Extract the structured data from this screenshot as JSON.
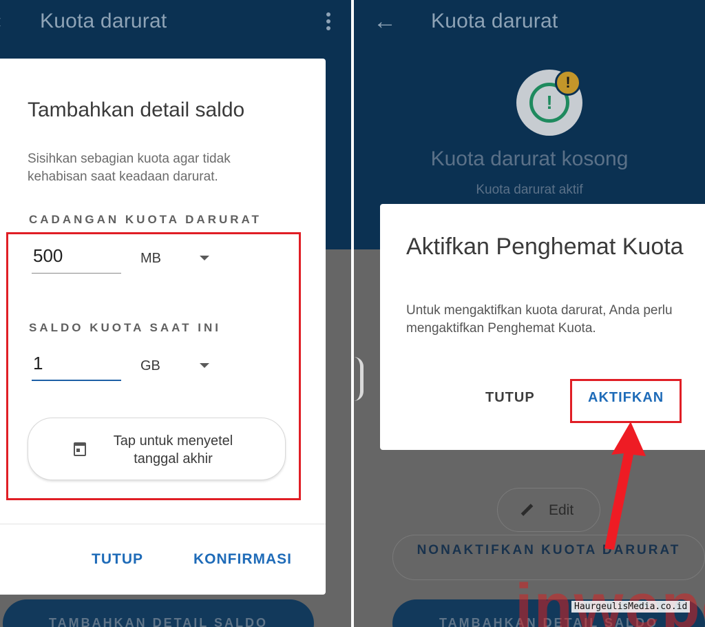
{
  "left": {
    "appbar": {
      "title": "Kuota darurat"
    },
    "dialog": {
      "title": "Tambahkan detail saldo",
      "description": "Sisihkan sebagian kuota agar tidak kehabisan saat keadaan darurat.",
      "reserve_label": "CADANGAN KUOTA DARURAT",
      "reserve_value": "500",
      "reserve_unit": "MB",
      "balance_label": "SALDO KUOTA SAAT INI",
      "balance_value": "1",
      "balance_unit": "GB",
      "date_button_label": "Tap untuk menyetel tanggal akhir",
      "close_label": "TUTUP",
      "confirm_label": "KONFIRMASI"
    },
    "background_button": "TAMBAHKAN DETAIL SALDO"
  },
  "right": {
    "appbar": {
      "title": "Kuota darurat"
    },
    "status_icon": "warning-badge-icon",
    "empty_title": "Kuota darurat kosong",
    "empty_subtitle": "Kuota darurat aktif",
    "edit_label": "Edit",
    "deactivate_label": "NONAKTIFKAN KUOTA DARURAT",
    "background_button": "TAMBAHKAN DETAIL SALDO",
    "dialog": {
      "title": "Aktifkan Penghemat Kuota",
      "body": "Untuk mengaktifkan kuota darurat, Anda perlu mengaktifkan Penghemat Kuota.",
      "close_label": "TUTUP",
      "activate_label": "AKTIFKAN"
    }
  },
  "watermark": {
    "big": "inwepo",
    "small": "HaurgeulisMedia.co.id"
  },
  "colors": {
    "appbar": "#0b3152",
    "accent": "#1e6bb8",
    "highlight": "#e01e25"
  }
}
